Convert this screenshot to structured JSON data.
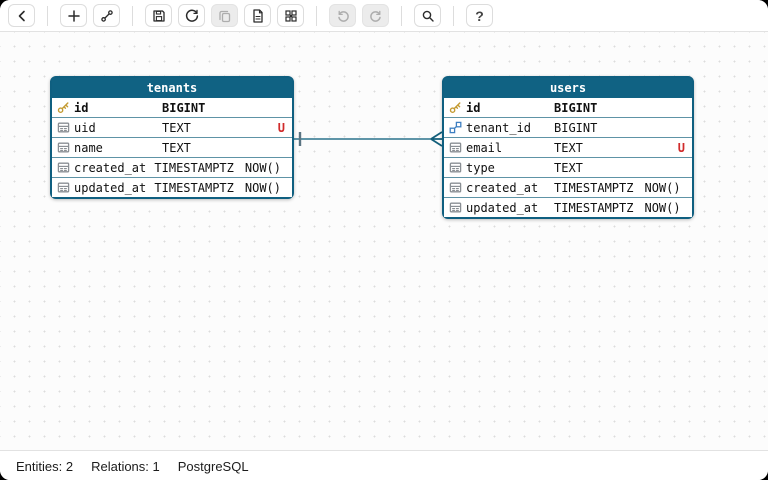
{
  "toolbar": {
    "icons": [
      "back-icon",
      "add-table-icon",
      "add-relation-icon",
      "save-icon",
      "reload-icon",
      "copy-icon",
      "export-sql-icon",
      "layout-grid-icon",
      "undo-icon",
      "redo-icon",
      "search-icon",
      "help-icon"
    ],
    "help_label": "?"
  },
  "diagram": {
    "tables": [
      {
        "name": "tenants",
        "columns": [
          {
            "icon": "primary-key",
            "name": "id",
            "type": "BIGINT",
            "default": "",
            "unique": ""
          },
          {
            "icon": "column",
            "name": "uid",
            "type": "TEXT",
            "default": "",
            "unique": "U"
          },
          {
            "icon": "column",
            "name": "name",
            "type": "TEXT",
            "default": "",
            "unique": ""
          },
          {
            "icon": "column",
            "name": "created_at",
            "type": "TIMESTAMPTZ",
            "default": "NOW()",
            "unique": ""
          },
          {
            "icon": "column",
            "name": "updated_at",
            "type": "TIMESTAMPTZ",
            "default": "NOW()",
            "unique": ""
          }
        ]
      },
      {
        "name": "users",
        "columns": [
          {
            "icon": "primary-key",
            "name": "id",
            "type": "BIGINT",
            "default": "",
            "unique": ""
          },
          {
            "icon": "foreign-key",
            "name": "tenant_id",
            "type": "BIGINT",
            "default": "",
            "unique": ""
          },
          {
            "icon": "column",
            "name": "email",
            "type": "TEXT",
            "default": "",
            "unique": "U"
          },
          {
            "icon": "column",
            "name": "type",
            "type": "TEXT",
            "default": "",
            "unique": ""
          },
          {
            "icon": "column",
            "name": "created_at",
            "type": "TIMESTAMPTZ",
            "default": "NOW()",
            "unique": ""
          },
          {
            "icon": "column",
            "name": "updated_at",
            "type": "TIMESTAMPTZ",
            "default": "NOW()",
            "unique": ""
          }
        ]
      }
    ],
    "relations": [
      {
        "from_table": "tenants",
        "to_table": "users",
        "from_cardinality": "one",
        "to_cardinality": "many"
      }
    ]
  },
  "statusbar": {
    "entities_label": "Entities: 2",
    "relations_label": "Relations: 1",
    "dialect_label": "PostgreSQL"
  },
  "colors": {
    "header_teal": "#106283",
    "border_teal": "#0f5f80",
    "row_separator": "#5e93a6",
    "relation_line": "#5f95a8",
    "primary_key_gold": "#c49b32",
    "foreign_key_blue": "#3d7fc1",
    "unique_red": "#d02b2b"
  }
}
